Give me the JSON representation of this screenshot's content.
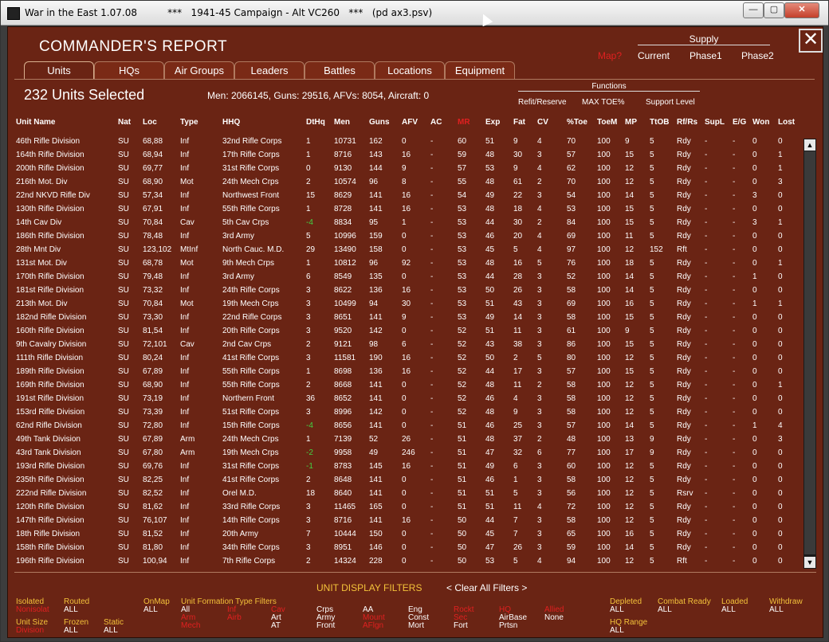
{
  "window": {
    "title": "War in the East 1.07.08          ***   1941-45 Campaign - Alt VC260   ***   (pd ax3.psv)",
    "minimize": "—",
    "maximize": "▢",
    "close": "✕"
  },
  "header": {
    "title": "COMMANDER'S REPORT",
    "close": "✕"
  },
  "supply": {
    "heading": "Supply",
    "mode": "Map?",
    "current": "Current",
    "phase1": "Phase1",
    "phase2": "Phase2"
  },
  "tabs": [
    {
      "label": "Units"
    },
    {
      "label": "HQs"
    },
    {
      "label": "Air Groups"
    },
    {
      "label": "Leaders"
    },
    {
      "label": "Battles"
    },
    {
      "label": "Locations"
    },
    {
      "label": "Equipment"
    }
  ],
  "summary": {
    "selected": "232 Units Selected",
    "stats": "Men: 2066145, Guns: 29516, AFVs: 8054, Aircraft: 0"
  },
  "functions": {
    "heading": "Functions",
    "refit": "Refit/Reserve",
    "maxtoe": "MAX TOE%",
    "support": "Support Level"
  },
  "columns": [
    "Unit Name",
    "Nat",
    "Loc",
    "Type",
    "HHQ",
    "DtHq",
    "Men",
    "Guns",
    "AFV",
    "AC",
    "MR",
    "Exp",
    "Fat",
    "CV",
    "%Toe",
    "ToeM",
    "MP",
    "TtOB",
    "Rf/Rs",
    "SupL",
    "E/G",
    "Won",
    "Lost"
  ],
  "rows": [
    [
      "46th Rifle Division",
      "SU",
      "68,88",
      "Inf",
      "32nd Rifle Corps",
      "1",
      "10731",
      "162",
      "0",
      "-",
      "60",
      "51",
      "9",
      "4",
      "70",
      "100",
      "9",
      "5",
      "Rdy",
      "-",
      "-",
      "0",
      "0"
    ],
    [
      "164th Rifle Division",
      "SU",
      "68,94",
      "Inf",
      "17th Rifle Corps",
      "1",
      "8716",
      "143",
      "16",
      "-",
      "59",
      "48",
      "30",
      "3",
      "57",
      "100",
      "15",
      "5",
      "Rdy",
      "-",
      "-",
      "0",
      "1"
    ],
    [
      "200th Rifle Division",
      "SU",
      "69,77",
      "Inf",
      "31st Rifle Corps",
      "0",
      "9130",
      "144",
      "9",
      "-",
      "57",
      "53",
      "9",
      "4",
      "62",
      "100",
      "12",
      "5",
      "Rdy",
      "-",
      "-",
      "0",
      "1"
    ],
    [
      "216th Mot. Div",
      "SU",
      "68,90",
      "Mot",
      "24th Mech Crps",
      "2",
      "10574",
      "96",
      "8",
      "-",
      "55",
      "48",
      "61",
      "2",
      "70",
      "100",
      "12",
      "5",
      "Rdy",
      "-",
      "-",
      "0",
      "3"
    ],
    [
      "22nd NKVD Rifle Div",
      "SU",
      "57,34",
      "Inf",
      "Northwest Front",
      "15",
      "8629",
      "141",
      "16",
      "-",
      "54",
      "49",
      "22",
      "3",
      "54",
      "100",
      "14",
      "5",
      "Rdy",
      "-",
      "-",
      "3",
      "0"
    ],
    [
      "130th Rifle Division",
      "SU",
      "67,91",
      "Inf",
      "55th Rifle Corps",
      "1",
      "8728",
      "141",
      "16",
      "-",
      "53",
      "48",
      "18",
      "4",
      "53",
      "100",
      "15",
      "5",
      "Rdy",
      "-",
      "-",
      "0",
      "0"
    ],
    [
      "14th Cav Div",
      "SU",
      "70,84",
      "Cav",
      "5th Cav Crps",
      "-4",
      "8834",
      "95",
      "1",
      "-",
      "53",
      "44",
      "30",
      "2",
      "84",
      "100",
      "15",
      "5",
      "Rdy",
      "-",
      "-",
      "3",
      "1"
    ],
    [
      "186th Rifle Division",
      "SU",
      "78,48",
      "Inf",
      "3rd Army",
      "5",
      "10996",
      "159",
      "0",
      "-",
      "53",
      "46",
      "20",
      "4",
      "69",
      "100",
      "11",
      "5",
      "Rdy",
      "-",
      "-",
      "0",
      "0"
    ],
    [
      "28th Mnt Div",
      "SU",
      "123,102",
      "MtInf",
      "North Cauc. M.D.",
      "29",
      "13490",
      "158",
      "0",
      "-",
      "53",
      "45",
      "5",
      "4",
      "97",
      "100",
      "12",
      "152",
      "Rft",
      "-",
      "-",
      "0",
      "0"
    ],
    [
      "131st Mot. Div",
      "SU",
      "68,78",
      "Mot",
      "9th Mech Crps",
      "1",
      "10812",
      "96",
      "92",
      "-",
      "53",
      "48",
      "16",
      "5",
      "76",
      "100",
      "18",
      "5",
      "Rdy",
      "-",
      "-",
      "0",
      "1"
    ],
    [
      "170th Rifle Division",
      "SU",
      "79,48",
      "Inf",
      "3rd Army",
      "6",
      "8549",
      "135",
      "0",
      "-",
      "53",
      "44",
      "28",
      "3",
      "52",
      "100",
      "14",
      "5",
      "Rdy",
      "-",
      "-",
      "1",
      "0"
    ],
    [
      "181st Rifle Division",
      "SU",
      "73,32",
      "Inf",
      "24th Rifle Corps",
      "3",
      "8622",
      "136",
      "16",
      "-",
      "53",
      "50",
      "26",
      "3",
      "58",
      "100",
      "14",
      "5",
      "Rdy",
      "-",
      "-",
      "0",
      "0"
    ],
    [
      "213th Mot. Div",
      "SU",
      "70,84",
      "Mot",
      "19th Mech Crps",
      "3",
      "10499",
      "94",
      "30",
      "-",
      "53",
      "51",
      "43",
      "3",
      "69",
      "100",
      "16",
      "5",
      "Rdy",
      "-",
      "-",
      "1",
      "1"
    ],
    [
      "182nd Rifle Division",
      "SU",
      "73,30",
      "Inf",
      "22nd Rifle Corps",
      "3",
      "8651",
      "141",
      "9",
      "-",
      "53",
      "49",
      "14",
      "3",
      "58",
      "100",
      "15",
      "5",
      "Rdy",
      "-",
      "-",
      "0",
      "0"
    ],
    [
      "160th Rifle Division",
      "SU",
      "81,54",
      "Inf",
      "20th Rifle Corps",
      "3",
      "9520",
      "142",
      "0",
      "-",
      "52",
      "51",
      "11",
      "3",
      "61",
      "100",
      "9",
      "5",
      "Rdy",
      "-",
      "-",
      "0",
      "0"
    ],
    [
      "9th Cavalry Division",
      "SU",
      "72,101",
      "Cav",
      "2nd Cav Crps",
      "2",
      "9121",
      "98",
      "6",
      "-",
      "52",
      "43",
      "38",
      "3",
      "86",
      "100",
      "15",
      "5",
      "Rdy",
      "-",
      "-",
      "0",
      "0"
    ],
    [
      "111th Rifle Division",
      "SU",
      "80,24",
      "Inf",
      "41st Rifle Corps",
      "3",
      "11581",
      "190",
      "16",
      "-",
      "52",
      "50",
      "2",
      "5",
      "80",
      "100",
      "12",
      "5",
      "Rdy",
      "-",
      "-",
      "0",
      "0"
    ],
    [
      "189th Rifle Division",
      "SU",
      "67,89",
      "Inf",
      "55th Rifle Corps",
      "1",
      "8698",
      "136",
      "16",
      "-",
      "52",
      "44",
      "17",
      "3",
      "57",
      "100",
      "15",
      "5",
      "Rdy",
      "-",
      "-",
      "0",
      "0"
    ],
    [
      "169th Rifle Division",
      "SU",
      "68,90",
      "Inf",
      "55th Rifle Corps",
      "2",
      "8668",
      "141",
      "0",
      "-",
      "52",
      "48",
      "11",
      "2",
      "58",
      "100",
      "12",
      "5",
      "Rdy",
      "-",
      "-",
      "0",
      "1"
    ],
    [
      "191st Rifle Division",
      "SU",
      "73,19",
      "Inf",
      "Northern Front",
      "36",
      "8652",
      "141",
      "0",
      "-",
      "52",
      "46",
      "4",
      "3",
      "58",
      "100",
      "12",
      "5",
      "Rdy",
      "-",
      "-",
      "0",
      "0"
    ],
    [
      "153rd Rifle Division",
      "SU",
      "73,39",
      "Inf",
      "51st Rifle Corps",
      "3",
      "8996",
      "142",
      "0",
      "-",
      "52",
      "48",
      "9",
      "3",
      "58",
      "100",
      "12",
      "5",
      "Rdy",
      "-",
      "-",
      "0",
      "0"
    ],
    [
      "62nd Rifle Division",
      "SU",
      "72,80",
      "Inf",
      "15th Rifle Corps",
      "-4",
      "8656",
      "141",
      "0",
      "-",
      "51",
      "46",
      "25",
      "3",
      "57",
      "100",
      "14",
      "5",
      "Rdy",
      "-",
      "-",
      "1",
      "4"
    ],
    [
      "49th Tank Division",
      "SU",
      "67,89",
      "Arm",
      "24th Mech Crps",
      "1",
      "7139",
      "52",
      "26",
      "-",
      "51",
      "48",
      "37",
      "2",
      "48",
      "100",
      "13",
      "9",
      "Rdy",
      "-",
      "-",
      "0",
      "3"
    ],
    [
      "43rd Tank Division",
      "SU",
      "67,80",
      "Arm",
      "19th Mech Crps",
      "-2",
      "9958",
      "49",
      "246",
      "-",
      "51",
      "47",
      "32",
      "6",
      "77",
      "100",
      "17",
      "9",
      "Rdy",
      "-",
      "-",
      "0",
      "0"
    ],
    [
      "193rd Rifle Division",
      "SU",
      "69,76",
      "Inf",
      "31st Rifle Corps",
      "-1",
      "8783",
      "145",
      "16",
      "-",
      "51",
      "49",
      "6",
      "3",
      "60",
      "100",
      "12",
      "5",
      "Rdy",
      "-",
      "-",
      "0",
      "0"
    ],
    [
      "235th Rifle Division",
      "SU",
      "82,25",
      "Inf",
      "41st Rifle Corps",
      "2",
      "8648",
      "141",
      "0",
      "-",
      "51",
      "46",
      "1",
      "3",
      "58",
      "100",
      "12",
      "5",
      "Rdy",
      "-",
      "-",
      "0",
      "0"
    ],
    [
      "222nd Rifle Division",
      "SU",
      "82,52",
      "Inf",
      "Orel M.D.",
      "18",
      "8640",
      "141",
      "0",
      "-",
      "51",
      "51",
      "5",
      "3",
      "56",
      "100",
      "12",
      "5",
      "Rsrv",
      "-",
      "-",
      "0",
      "0"
    ],
    [
      "120th Rifle Division",
      "SU",
      "81,62",
      "Inf",
      "33rd Rifle Corps",
      "3",
      "11465",
      "165",
      "0",
      "-",
      "51",
      "51",
      "11",
      "4",
      "72",
      "100",
      "12",
      "5",
      "Rdy",
      "-",
      "-",
      "0",
      "0"
    ],
    [
      "147th Rifle Division",
      "SU",
      "76,107",
      "Inf",
      "14th Rifle Corps",
      "3",
      "8716",
      "141",
      "16",
      "-",
      "50",
      "44",
      "7",
      "3",
      "58",
      "100",
      "12",
      "5",
      "Rdy",
      "-",
      "-",
      "0",
      "0"
    ],
    [
      "18th Rifle Division",
      "SU",
      "81,52",
      "Inf",
      "20th Army",
      "7",
      "10444",
      "150",
      "0",
      "-",
      "50",
      "45",
      "7",
      "3",
      "65",
      "100",
      "16",
      "5",
      "Rdy",
      "-",
      "-",
      "0",
      "0"
    ],
    [
      "158th Rifle Division",
      "SU",
      "81,80",
      "Inf",
      "34th Rifle Corps",
      "3",
      "8951",
      "146",
      "0",
      "-",
      "50",
      "47",
      "26",
      "3",
      "59",
      "100",
      "14",
      "5",
      "Rdy",
      "-",
      "-",
      "0",
      "0"
    ],
    [
      "196th Rifle Division",
      "SU",
      "100,94",
      "Inf",
      "7th Rifle Corps",
      "2",
      "14324",
      "228",
      "0",
      "-",
      "50",
      "53",
      "5",
      "4",
      "94",
      "100",
      "12",
      "5",
      "Rft",
      "-",
      "-",
      "0",
      "0"
    ]
  ],
  "highlight_color": "#43d143",
  "filters": {
    "title": "UNIT DISPLAY FILTERS",
    "clear": "< Clear All Filters >",
    "isolated": "Isolated",
    "isolated_val": "Nonisolat",
    "routed": "Routed",
    "routed_val": "ALL",
    "unit_size": "Unit Size",
    "unit_size_val": "Division",
    "frozen": "Frozen",
    "frozen_val": "ALL",
    "static": "Static",
    "static_val": "ALL",
    "onmap": "OnMap",
    "onmap_val": "ALL",
    "type_filters": "Unit  Formation  Type  Filters",
    "f_all": "All",
    "f_arm": "Arm",
    "f_mech": "Mech",
    "f_inf": "Inf",
    "f_airb": "Airb",
    "f_cav": "Cav",
    "f_art": "Art",
    "f_at": "AT",
    "f_crps": "Crps",
    "f_army": "Army",
    "f_front": "Front",
    "f_aa": "AA",
    "f_mnt": "Mount",
    "f_aflgn": "AFlgn",
    "f_eng": "Eng",
    "f_const": "Const",
    "f_mort": "Mort",
    "f_rockt": "Rockt",
    "f_sec": "Sec",
    "f_fort": "Fort",
    "f_hq": "HQ",
    "f_airbase": "AirBase",
    "f_prtsn": "Prtsn",
    "f_allied": "Allied",
    "f_none": "None",
    "depleted": "Depleted",
    "depleted_val": "ALL",
    "combat": "Combat Ready",
    "combat_val": "ALL",
    "loaded": "Loaded",
    "loaded_val": "ALL",
    "withdraw": "Withdraw",
    "withdraw_val": "ALL",
    "hqrange": "HQ Range",
    "hqrange_val": "ALL"
  }
}
